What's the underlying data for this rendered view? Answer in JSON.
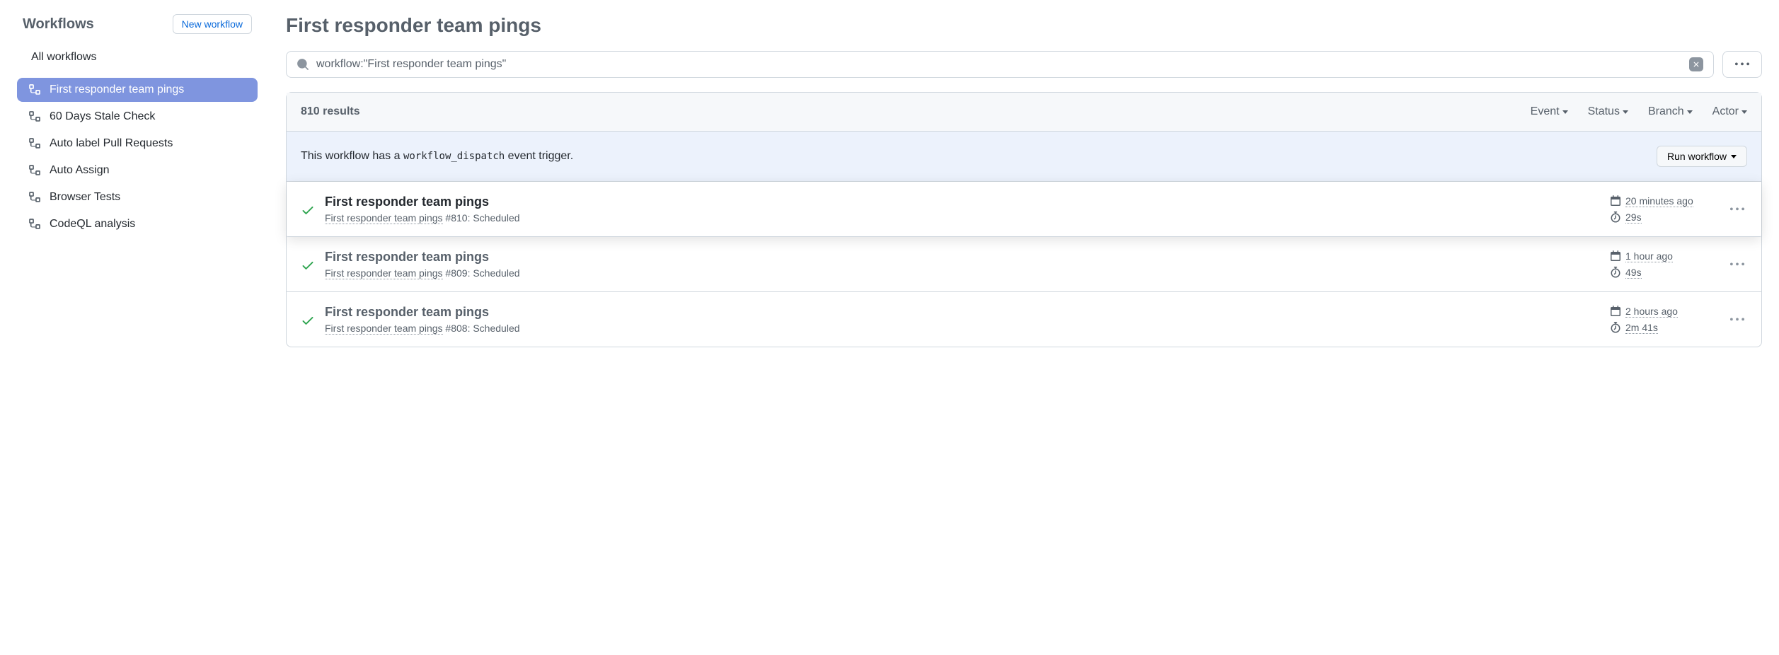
{
  "sidebar": {
    "title": "Workflows",
    "new_button": "New workflow",
    "all_label": "All workflows",
    "items": [
      {
        "label": "First responder team pings",
        "active": true
      },
      {
        "label": "60 Days Stale Check",
        "active": false
      },
      {
        "label": "Auto label Pull Requests",
        "active": false
      },
      {
        "label": "Auto Assign",
        "active": false
      },
      {
        "label": "Browser Tests",
        "active": false
      },
      {
        "label": "CodeQL analysis",
        "active": false
      }
    ]
  },
  "main": {
    "title": "First responder team pings",
    "search_value": "workflow:\"First responder team pings\"",
    "results_count": "810 results",
    "filters": {
      "event": "Event",
      "status": "Status",
      "branch": "Branch",
      "actor": "Actor"
    },
    "dispatch": {
      "prefix": "This workflow has a ",
      "code": "workflow_dispatch",
      "suffix": " event trigger.",
      "button": "Run workflow"
    },
    "runs": [
      {
        "title": "First responder team pings",
        "workflow": "First responder team pings",
        "run_suffix": " #810: Scheduled",
        "time": "20 minutes ago",
        "duration": "29s",
        "highlighted": true
      },
      {
        "title": "First responder team pings",
        "workflow": "First responder team pings",
        "run_suffix": " #809: Scheduled",
        "time": "1 hour ago",
        "duration": "49s",
        "highlighted": false
      },
      {
        "title": "First responder team pings",
        "workflow": "First responder team pings",
        "run_suffix": " #808: Scheduled",
        "time": "2 hours ago",
        "duration": "2m 41s",
        "highlighted": false
      }
    ]
  }
}
